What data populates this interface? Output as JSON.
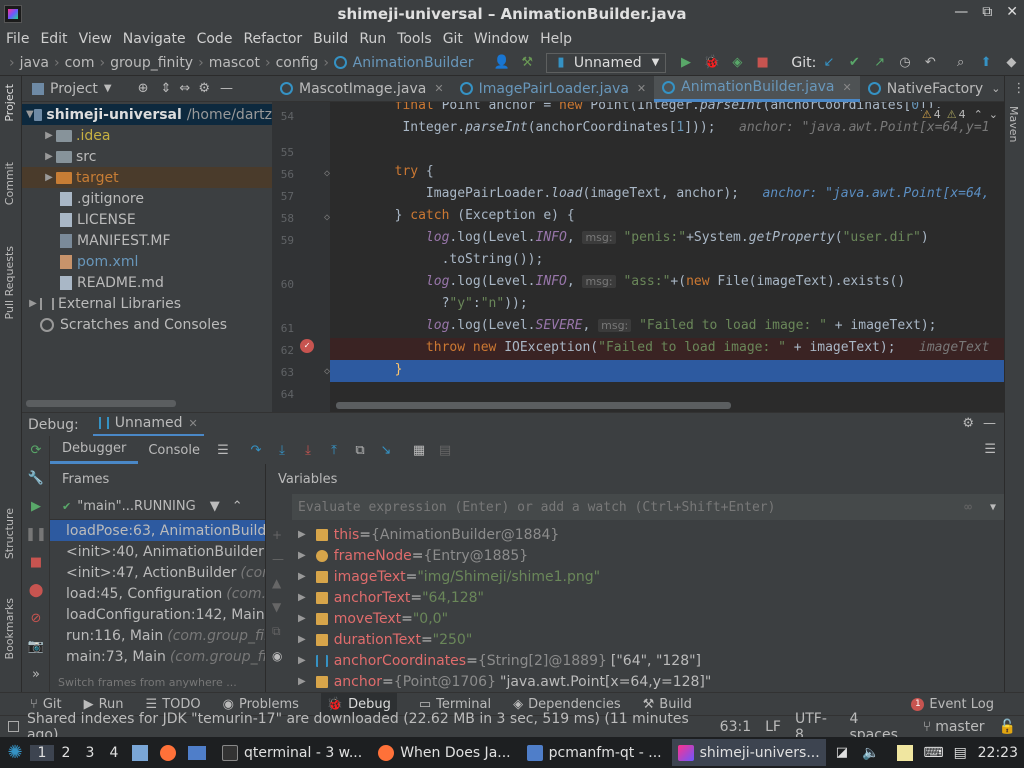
{
  "window": {
    "title": "shimeji-universal – AnimationBuilder.java"
  },
  "menu": [
    "File",
    "Edit",
    "View",
    "Navigate",
    "Code",
    "Refactor",
    "Build",
    "Run",
    "Tools",
    "Git",
    "Window",
    "Help"
  ],
  "breadcrumbs": [
    "java",
    "com",
    "group_finity",
    "mascot",
    "config",
    "AnimationBuilder"
  ],
  "run_config": "Unnamed",
  "git_label": "Git:",
  "project_panel": {
    "title": "Project",
    "tree": [
      {
        "label": "shimeji-universal",
        "path": "/home/dartz",
        "level": 0,
        "expanded": true,
        "kind": "module"
      },
      {
        "label": ".idea",
        "level": 1,
        "expanded": false,
        "kind": "folder"
      },
      {
        "label": "src",
        "level": 1,
        "expanded": false,
        "kind": "folder"
      },
      {
        "label": "target",
        "level": 1,
        "expanded": false,
        "kind": "folder-orange"
      },
      {
        "label": ".gitignore",
        "level": 1,
        "kind": "file"
      },
      {
        "label": "LICENSE",
        "level": 1,
        "kind": "file"
      },
      {
        "label": "MANIFEST.MF",
        "level": 1,
        "kind": "file-m"
      },
      {
        "label": "pom.xml",
        "level": 1,
        "kind": "file-xml"
      },
      {
        "label": "README.md",
        "level": 1,
        "kind": "file"
      },
      {
        "label": "External Libraries",
        "level": 0,
        "expanded": false,
        "kind": "lib"
      },
      {
        "label": "Scratches and Consoles",
        "level": 0,
        "kind": "scratch"
      }
    ]
  },
  "editor_tabs": [
    {
      "label": "MascotImage.java",
      "active": false
    },
    {
      "label": "ImagePairLoader.java",
      "active": false
    },
    {
      "label": "AnimationBuilder.java",
      "active": true
    },
    {
      "label": "NativeFactory",
      "active": false
    }
  ],
  "editor": {
    "warning_count": "4",
    "weak_warning_count": "4",
    "lines": [
      {
        "num": "54",
        "text": "        final Point anchor = new Point(Integer.parseInt(anchorCoordinates"
      },
      {
        "num": "",
        "text": "         Integer.parseInt(anchorCoordinates[1]));",
        "inline": "anchor: \"java.awt.Point[x=64,y=1"
      },
      {
        "num": "55",
        "text": ""
      },
      {
        "num": "56",
        "text": "        try {"
      },
      {
        "num": "57",
        "text": "            ImagePairLoader.load(imageText, anchor);",
        "inline": "anchor: \"java.awt.Point[x=64,"
      },
      {
        "num": "58",
        "text": "        } catch (Exception e) {"
      },
      {
        "num": "59",
        "text": "            log.log(Level.INFO, msg: \"penis:\"+System.getProperty(\"user.dir\")"
      },
      {
        "num": "",
        "text": "              .toString());"
      },
      {
        "num": "60",
        "text": "            log.log(Level.INFO, msg: \"ass:\"+(new File(imageText).exists()"
      },
      {
        "num": "",
        "text": "              ?\"y\":\"n\"));"
      },
      {
        "num": "61",
        "text": "            log.log(Level.SEVERE, msg: \"Failed to load image: \" + imageText);"
      },
      {
        "num": "62",
        "text": "            throw new IOException(\"Failed to load image: \" + imageText);",
        "inline": "imageText"
      },
      {
        "num": "63",
        "text": "        }"
      },
      {
        "num": "64",
        "text": ""
      }
    ]
  },
  "debug": {
    "title": "Debug:",
    "session": "Unnamed",
    "tabs": [
      "Debugger",
      "Console"
    ],
    "frames_title": "Frames",
    "variables_title": "Variables",
    "thread": "\"main\"...RUNNING",
    "frames": [
      {
        "method": "loadPose:63, AnimationBuilder",
        "pkg": "",
        "selected": true
      },
      {
        "method": "<init>:40, AnimationBuilder",
        "pkg": "(c",
        "selected": false
      },
      {
        "method": "<init>:47, ActionBuilder",
        "pkg": "(com.",
        "selected": false
      },
      {
        "method": "load:45, Configuration",
        "pkg": "(com.gr",
        "selected": false
      },
      {
        "method": "loadConfiguration:142, Main",
        "pkg": "(c",
        "selected": false
      },
      {
        "method": "run:116, Main",
        "pkg": "(com.group_finit",
        "selected": false
      },
      {
        "method": "main:73, Main",
        "pkg": "(com.group_fin",
        "selected": false
      }
    ],
    "switch_frames_hint": "Switch frames from anywhere ...",
    "eval_placeholder": "Evaluate expression (Enter) or add a watch (Ctrl+Shift+Enter)",
    "variables": [
      {
        "name": "this",
        "value": "{AnimationBuilder@1884}",
        "str": "",
        "icon": "field"
      },
      {
        "name": "frameNode",
        "value": "{Entry@1885}",
        "str": "",
        "icon": "param"
      },
      {
        "name": "imageText",
        "value": "",
        "str": "\"img/Shimeji/shime1.png\"",
        "icon": "field"
      },
      {
        "name": "anchorText",
        "value": "",
        "str": "\"64,128\"",
        "icon": "field"
      },
      {
        "name": "moveText",
        "value": "",
        "str": "\"0,0\"",
        "icon": "field"
      },
      {
        "name": "durationText",
        "value": "",
        "str": "\"250\"",
        "icon": "field"
      },
      {
        "name": "anchorCoordinates",
        "value": "{String[2]@1889}",
        "str": "[\"64\", \"128\"]",
        "icon": "list"
      },
      {
        "name": "anchor",
        "value": "{Point@1706}",
        "str": "\"java.awt.Point[x=64,y=128]\"",
        "icon": "field"
      }
    ]
  },
  "stripes": {
    "left": [
      "Project",
      "Commit",
      "Pull Requests"
    ],
    "left_bottom": [
      "Structure",
      "Bookmarks"
    ],
    "right": [
      "Maven"
    ]
  },
  "tool_windows": [
    "Git",
    "Run",
    "TODO",
    "Problems",
    "Debug",
    "Terminal",
    "Dependencies",
    "Build"
  ],
  "event_log": {
    "count": "1",
    "label": "Event Log"
  },
  "status": {
    "message": "Shared indexes for JDK \"temurin-17\" are downloaded (22.62 MB in 3 sec, 519 ms) (11 minutes ago)",
    "position": "63:1",
    "line_sep": "LF",
    "encoding": "UTF-8",
    "indent": "4 spaces",
    "branch": "master"
  },
  "taskbar": {
    "workspaces": [
      "1",
      "2",
      "3",
      "4"
    ],
    "tasks": [
      {
        "label": "qterminal - 3 w...",
        "active": false
      },
      {
        "label": "When Does Ja...",
        "active": false
      },
      {
        "label": "pcmanfm-qt - ...",
        "active": false
      },
      {
        "label": "shimeji-univers...",
        "active": true
      }
    ],
    "clock": "22:23"
  },
  "colors": {
    "accent": "#4a88c7",
    "selection": "#2d5aa0",
    "background": "#2b2b2b",
    "panel": "#3c3f41",
    "breakpoint": "#c75450"
  }
}
